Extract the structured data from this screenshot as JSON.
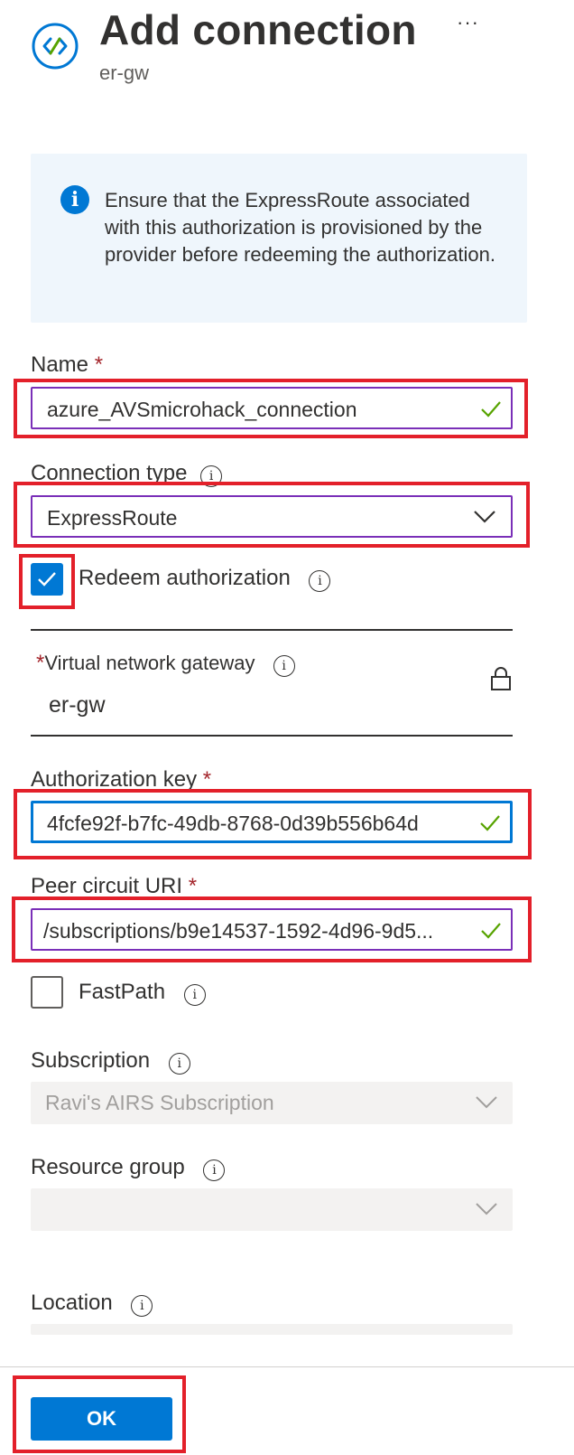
{
  "header": {
    "title": "Add connection",
    "subtitle": "er-gw",
    "more_label": "···",
    "icon": "connection-icon"
  },
  "info_banner": {
    "icon": "info-icon",
    "text": "Ensure that the ExpressRoute associated with this authorization is provisioned by the provider before redeeming the authorization."
  },
  "form": {
    "name": {
      "label": "Name",
      "required": "*",
      "value": "azure_AVSmicrohack_connection"
    },
    "connection_type": {
      "label": "Connection type",
      "value": "ExpressRoute"
    },
    "redeem_authorization": {
      "label": "Redeem authorization",
      "checked": true
    },
    "virtual_network_gateway": {
      "required": "*",
      "label": "Virtual network gateway",
      "value": "er-gw"
    },
    "authorization_key": {
      "label": "Authorization key",
      "required": "*",
      "value": "4fcfe92f-b7fc-49db-8768-0d39b556b64d"
    },
    "peer_circuit_uri": {
      "label": "Peer circuit URI",
      "required": "*",
      "value": "/subscriptions/b9e14537-1592-4d96-9d5..."
    },
    "fastpath": {
      "label": "FastPath",
      "checked": false
    },
    "subscription": {
      "label": "Subscription",
      "value": "Ravi's AIRS Subscription"
    },
    "resource_group": {
      "label": "Resource group",
      "value": ""
    },
    "location": {
      "label": "Location"
    }
  },
  "footer": {
    "ok_label": "OK"
  },
  "colors": {
    "accent": "#0078d4",
    "highlight_red": "#e3202a",
    "field_border_purple": "#7a2fb8",
    "success_green": "#57a300",
    "required_red": "#a4262c"
  }
}
